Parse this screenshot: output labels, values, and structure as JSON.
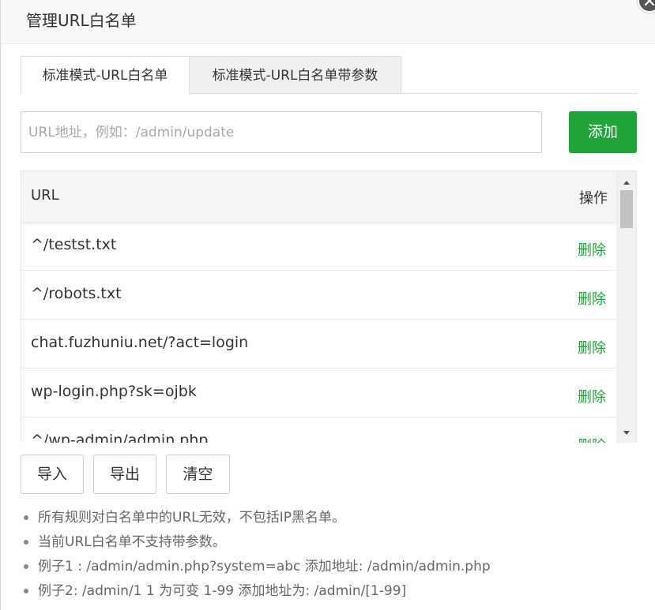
{
  "dialog": {
    "title": "管理URL白名单"
  },
  "tabs": [
    {
      "label": "标准模式-URL白名单",
      "active": true
    },
    {
      "label": "标准模式-URL白名单带参数",
      "active": false
    }
  ],
  "input": {
    "placeholder": "URL地址，例如：/admin/update",
    "value": ""
  },
  "add_button": "添加",
  "table": {
    "headers": {
      "url": "URL",
      "op": "操作"
    },
    "rows": [
      {
        "url": "^/testst.txt",
        "action": "删除"
      },
      {
        "url": "^/robots.txt",
        "action": "删除"
      },
      {
        "url": "chat.fuzhuniu.net/?act=login",
        "action": "删除"
      },
      {
        "url": "wp-login.php?sk=ojbk",
        "action": "删除"
      },
      {
        "url": "^/wp-admin/admin.php",
        "action": "删除"
      }
    ]
  },
  "buttons": {
    "import": "导入",
    "export": "导出",
    "clear": "清空"
  },
  "notes": [
    "所有规则对白名单中的URL无效，不包括IP黑名单。",
    "当前URL白名单不支持带参数。",
    "例子1 : /admin/admin.php?system=abc 添加地址: /admin/admin.php",
    "例子2: /admin/1 1 为可变 1-99 添加地址为: /admin/[1-99]"
  ],
  "colors": {
    "accent": "#20a53a",
    "border": "#dddddd",
    "header_bg": "#f8f8f8"
  },
  "icons": {
    "close": "close-icon"
  }
}
